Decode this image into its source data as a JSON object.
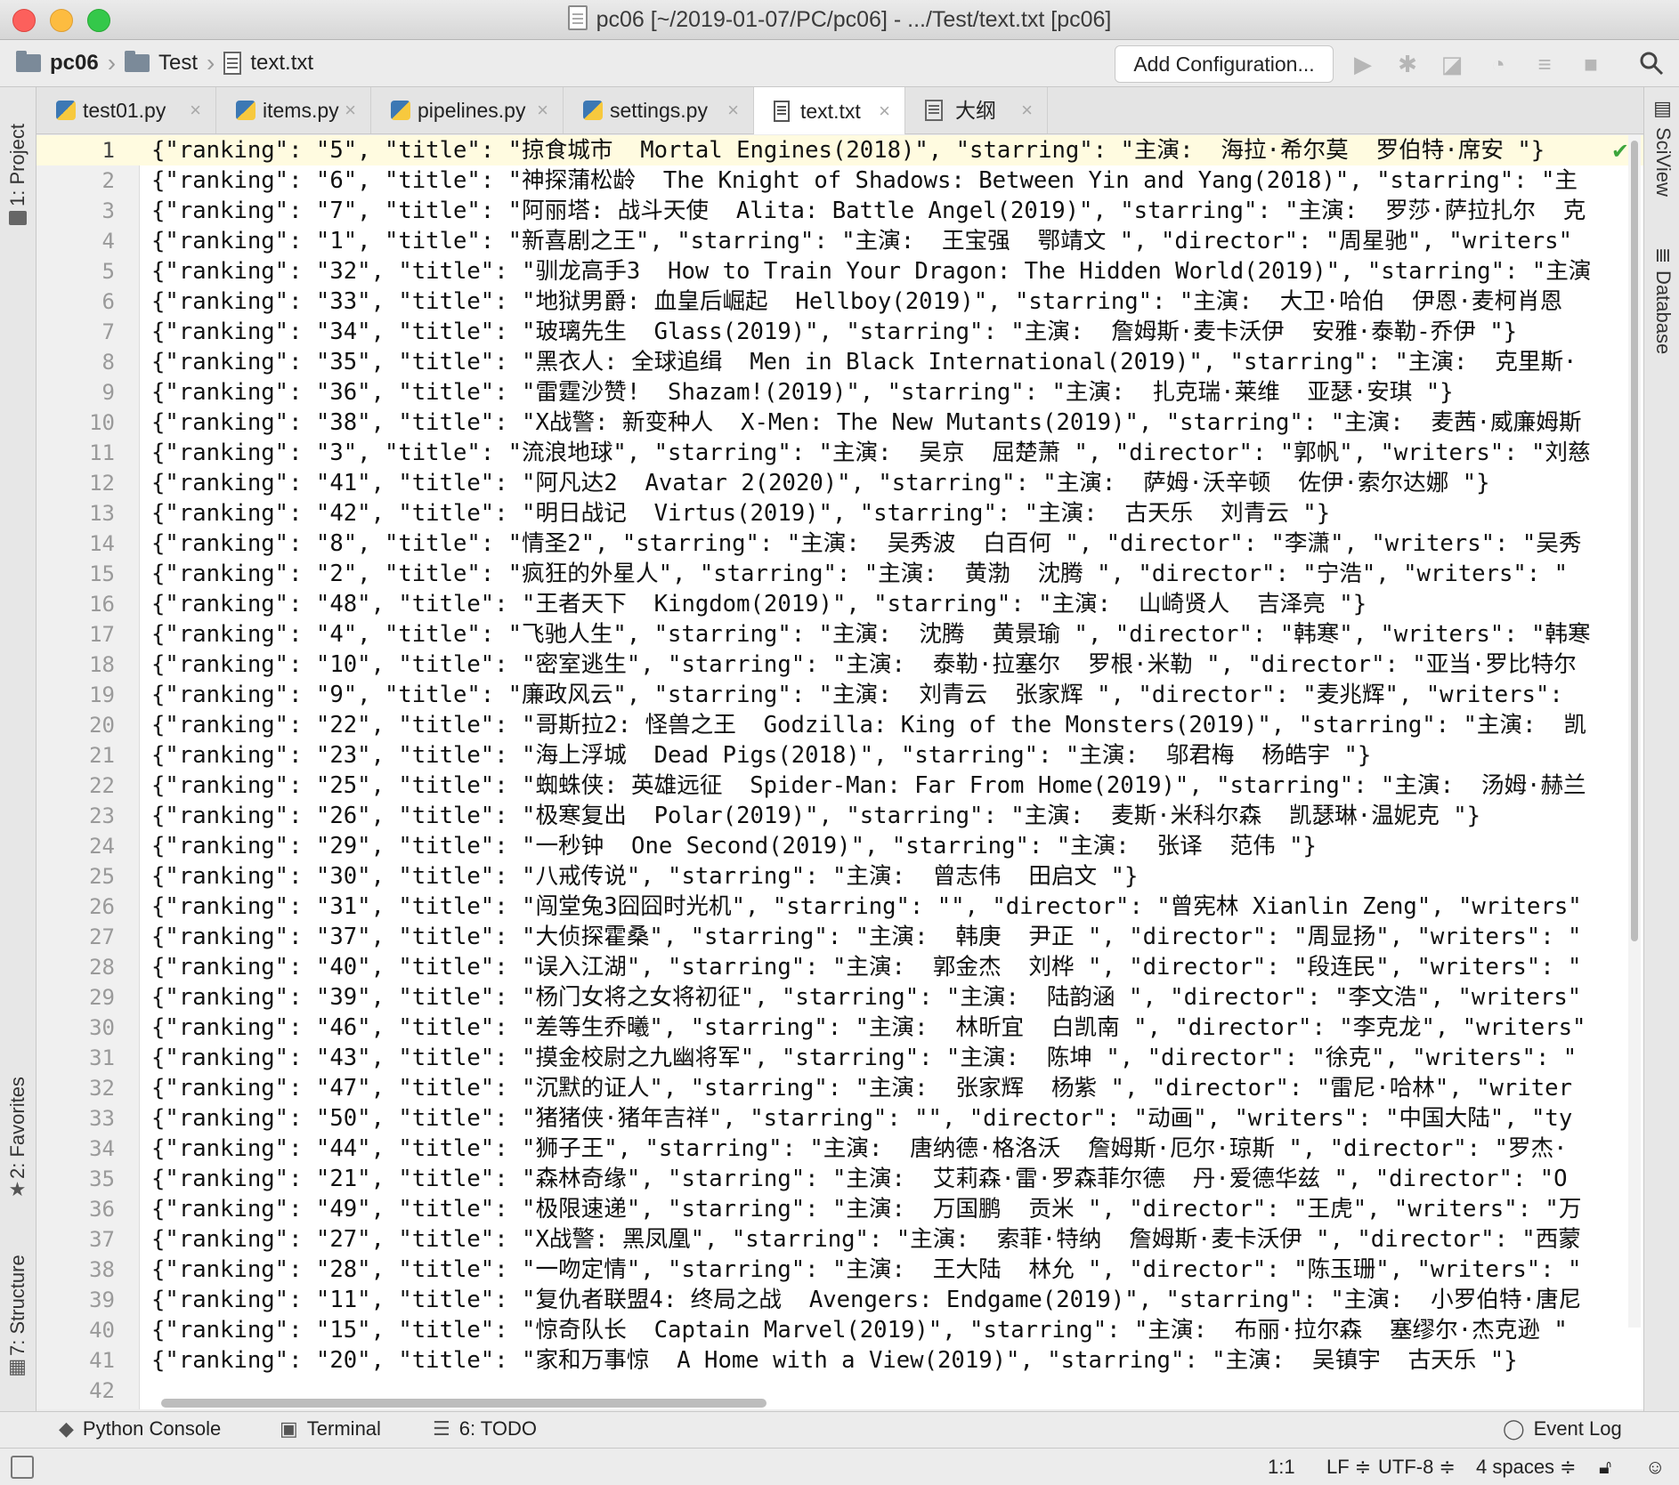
{
  "window": {
    "title": "pc06 [~/2019-01-07/PC/pc06] - .../Test/text.txt [pc06]"
  },
  "navbar": {
    "breadcrumb": [
      "pc06",
      "Test",
      "text.txt"
    ],
    "add_config": "Add Configuration..."
  },
  "left_tools": {
    "project": "1: Project",
    "favorites": "2: Favorites",
    "structure": "7: Structure"
  },
  "right_tools": {
    "sciview": "SciView",
    "database": "Database"
  },
  "tabs": [
    {
      "label": "test01.py"
    },
    {
      "label": "items.py"
    },
    {
      "label": "pipelines.py"
    },
    {
      "label": "settings.py"
    },
    {
      "label": "text.txt"
    },
    {
      "label": "大纲"
    }
  ],
  "editor": {
    "line_numbers": [
      "1",
      "2",
      "3",
      "4",
      "5",
      "6",
      "7",
      "8",
      "9",
      "10",
      "11",
      "12",
      "13",
      "14",
      "15",
      "16",
      "17",
      "18",
      "19",
      "20",
      "21",
      "22",
      "23",
      "24",
      "25",
      "26",
      "27",
      "28",
      "29",
      "30",
      "31",
      "32",
      "33",
      "34",
      "35",
      "36",
      "37",
      "38",
      "39",
      "40",
      "41",
      "42"
    ],
    "lines": [
      "{\"ranking\": \"5\", \"title\": \"掠食城市  Mortal Engines(2018)\", \"starring\": \"主演:  海拉·希尔莫  罗伯特·席安 \"}",
      "{\"ranking\": \"6\", \"title\": \"神探蒲松龄  The Knight of Shadows: Between Yin and Yang(2018)\", \"starring\": \"主",
      "{\"ranking\": \"7\", \"title\": \"阿丽塔: 战斗天使  Alita: Battle Angel(2019)\", \"starring\": \"主演:  罗莎·萨拉扎尔  克",
      "{\"ranking\": \"1\", \"title\": \"新喜剧之王\", \"starring\": \"主演:  王宝强  鄂靖文 \", \"director\": \"周星驰\", \"writers\"",
      "{\"ranking\": \"32\", \"title\": \"驯龙高手3  How to Train Your Dragon: The Hidden World(2019)\", \"starring\": \"主演",
      "{\"ranking\": \"33\", \"title\": \"地狱男爵: 血皇后崛起  Hellboy(2019)\", \"starring\": \"主演:  大卫·哈伯  伊恩·麦柯肖恩",
      "{\"ranking\": \"34\", \"title\": \"玻璃先生  Glass(2019)\", \"starring\": \"主演:  詹姆斯·麦卡沃伊  安雅·泰勒-乔伊 \"}",
      "{\"ranking\": \"35\", \"title\": \"黑衣人: 全球追缉  Men in Black International(2019)\", \"starring\": \"主演:  克里斯·",
      "{\"ranking\": \"36\", \"title\": \"雷霆沙赞!  Shazam!(2019)\", \"starring\": \"主演:  扎克瑞·莱维  亚瑟·安琪 \"}",
      "{\"ranking\": \"38\", \"title\": \"X战警: 新变种人  X-Men: The New Mutants(2019)\", \"starring\": \"主演:  麦茜·威廉姆斯",
      "{\"ranking\": \"3\", \"title\": \"流浪地球\", \"starring\": \"主演:  吴京  屈楚萧 \", \"director\": \"郭帆\", \"writers\": \"刘慈",
      "{\"ranking\": \"41\", \"title\": \"阿凡达2  Avatar 2(2020)\", \"starring\": \"主演:  萨姆·沃辛顿  佐伊·索尔达娜 \"}",
      "{\"ranking\": \"42\", \"title\": \"明日战记  Virtus(2019)\", \"starring\": \"主演:  古天乐  刘青云 \"}",
      "{\"ranking\": \"8\", \"title\": \"情圣2\", \"starring\": \"主演:  吴秀波  白百何 \", \"director\": \"李潇\", \"writers\": \"吴秀",
      "{\"ranking\": \"2\", \"title\": \"疯狂的外星人\", \"starring\": \"主演:  黄渤  沈腾 \", \"director\": \"宁浩\", \"writers\": \"",
      "{\"ranking\": \"48\", \"title\": \"王者天下  Kingdom(2019)\", \"starring\": \"主演:  山崎贤人  吉泽亮 \"}",
      "{\"ranking\": \"4\", \"title\": \"飞驰人生\", \"starring\": \"主演:  沈腾  黄景瑜 \", \"director\": \"韩寒\", \"writers\": \"韩寒",
      "{\"ranking\": \"10\", \"title\": \"密室逃生\", \"starring\": \"主演:  泰勒·拉塞尔  罗根·米勒 \", \"director\": \"亚当·罗比特尔",
      "{\"ranking\": \"9\", \"title\": \"廉政风云\", \"starring\": \"主演:  刘青云  张家辉 \", \"director\": \"麦兆辉\", \"writers\":",
      "{\"ranking\": \"22\", \"title\": \"哥斯拉2: 怪兽之王  Godzilla: King of the Monsters(2019)\", \"starring\": \"主演:  凯",
      "{\"ranking\": \"23\", \"title\": \"海上浮城  Dead Pigs(2018)\", \"starring\": \"主演:  邬君梅  杨皓宇 \"}",
      "{\"ranking\": \"25\", \"title\": \"蜘蛛侠: 英雄远征  Spider-Man: Far From Home(2019)\", \"starring\": \"主演:  汤姆·赫兰",
      "{\"ranking\": \"26\", \"title\": \"极寒复出  Polar(2019)\", \"starring\": \"主演:  麦斯·米科尔森  凯瑟琳·温妮克 \"}",
      "{\"ranking\": \"29\", \"title\": \"一秒钟  One Second(2019)\", \"starring\": \"主演:  张译  范伟 \"}",
      "{\"ranking\": \"30\", \"title\": \"八戒传说\", \"starring\": \"主演:  曾志伟  田启文 \"}",
      "{\"ranking\": \"31\", \"title\": \"闯堂兔3囧囧时光机\", \"starring\": \"\", \"director\": \"曾宪林 Xianlin Zeng\", \"writers\"",
      "{\"ranking\": \"37\", \"title\": \"大侦探霍桑\", \"starring\": \"主演:  韩庚  尹正 \", \"director\": \"周显扬\", \"writers\": \"",
      "{\"ranking\": \"40\", \"title\": \"误入江湖\", \"starring\": \"主演:  郭金杰  刘桦 \", \"director\": \"段连民\", \"writers\": \"",
      "{\"ranking\": \"39\", \"title\": \"杨门女将之女将初征\", \"starring\": \"主演:  陆韵涵 \", \"director\": \"李文浩\", \"writers\"",
      "{\"ranking\": \"46\", \"title\": \"差等生乔曦\", \"starring\": \"主演:  林昕宜  白凯南 \", \"director\": \"李克龙\", \"writers\"",
      "{\"ranking\": \"43\", \"title\": \"摸金校尉之九幽将军\", \"starring\": \"主演:  陈坤 \", \"director\": \"徐克\", \"writers\": \"",
      "{\"ranking\": \"47\", \"title\": \"沉默的证人\", \"starring\": \"主演:  张家辉  杨紫 \", \"director\": \"雷尼·哈林\", \"writer",
      "{\"ranking\": \"50\", \"title\": \"猪猪侠·猪年吉祥\", \"starring\": \"\", \"director\": \"动画\", \"writers\": \"中国大陆\", \"ty",
      "{\"ranking\": \"44\", \"title\": \"狮子王\", \"starring\": \"主演:  唐纳德·格洛沃  詹姆斯·厄尔·琼斯 \", \"director\": \"罗杰·",
      "{\"ranking\": \"21\", \"title\": \"森林奇缘\", \"starring\": \"主演:  艾莉森·雷·罗森菲尔德  丹·爱德华兹 \", \"director\": \"O",
      "{\"ranking\": \"49\", \"title\": \"极限速递\", \"starring\": \"主演:  万国鹏  贡米 \", \"director\": \"王虎\", \"writers\": \"万",
      "{\"ranking\": \"27\", \"title\": \"X战警: 黑凤凰\", \"starring\": \"主演:  索菲·特纳  詹姆斯·麦卡沃伊 \", \"director\": \"西蒙",
      "{\"ranking\": \"28\", \"title\": \"一吻定情\", \"starring\": \"主演:  王大陆  林允 \", \"director\": \"陈玉珊\", \"writers\": \"",
      "{\"ranking\": \"11\", \"title\": \"复仇者联盟4: 终局之战  Avengers: Endgame(2019)\", \"starring\": \"主演:  小罗伯特·唐尼",
      "{\"ranking\": \"15\", \"title\": \"惊奇队长  Captain Marvel(2019)\", \"starring\": \"主演:  布丽·拉尔森  塞缪尔·杰克逊 \"",
      "{\"ranking\": \"20\", \"title\": \"家和万事惊  A Home with a View(2019)\", \"starring\": \"主演:  吴镇宇  古天乐 \"}",
      ""
    ]
  },
  "bottom_tools": {
    "python_console": "Python Console",
    "terminal": "Terminal",
    "todo": "6: TODO",
    "event_log": "Event Log"
  },
  "status": {
    "position": "1:1",
    "line_sep": "LF ≑",
    "encoding": "UTF-8 ≑",
    "indent": "4 spaces ≑"
  }
}
